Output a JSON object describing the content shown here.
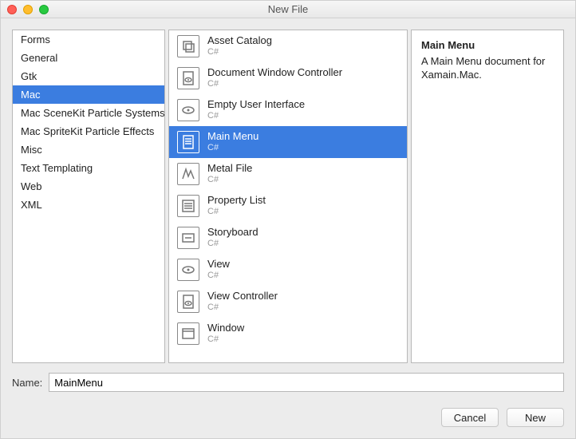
{
  "window": {
    "title": "New File"
  },
  "categories": [
    {
      "label": "Forms",
      "selected": false
    },
    {
      "label": "General",
      "selected": false
    },
    {
      "label": "Gtk",
      "selected": false
    },
    {
      "label": "Mac",
      "selected": true
    },
    {
      "label": "Mac SceneKit Particle Systems",
      "selected": false
    },
    {
      "label": "Mac SpriteKit Particle Effects",
      "selected": false
    },
    {
      "label": "Misc",
      "selected": false
    },
    {
      "label": "Text Templating",
      "selected": false
    },
    {
      "label": "Web",
      "selected": false
    },
    {
      "label": "XML",
      "selected": false
    }
  ],
  "templates": [
    {
      "label": "Asset Catalog",
      "sub": "C#",
      "icon": "stack",
      "selected": false
    },
    {
      "label": "Document Window Controller",
      "sub": "C#",
      "icon": "doc-eye",
      "selected": false
    },
    {
      "label": "Empty User Interface",
      "sub": "C#",
      "icon": "eye",
      "selected": false
    },
    {
      "label": "Main Menu",
      "sub": "C#",
      "icon": "doc-lines",
      "selected": true
    },
    {
      "label": "Metal File",
      "sub": "C#",
      "icon": "metal",
      "selected": false
    },
    {
      "label": "Property List",
      "sub": "C#",
      "icon": "list",
      "selected": false
    },
    {
      "label": "Storyboard",
      "sub": "C#",
      "icon": "storyboard",
      "selected": false
    },
    {
      "label": "View",
      "sub": "C#",
      "icon": "eye",
      "selected": false
    },
    {
      "label": "View Controller",
      "sub": "C#",
      "icon": "doc-eye",
      "selected": false
    },
    {
      "label": "Window",
      "sub": "C#",
      "icon": "window",
      "selected": false
    }
  ],
  "description": {
    "title": "Main Menu",
    "body": "A Main Menu document for Xamain.Mac."
  },
  "name_field": {
    "label": "Name:",
    "value": "MainMenu"
  },
  "buttons": {
    "cancel": "Cancel",
    "new": "New"
  },
  "icons": {
    "stack": "stack-icon",
    "doc-eye": "doc-eye-icon",
    "eye": "eye-icon",
    "doc-lines": "doc-lines-icon",
    "metal": "metal-icon",
    "list": "list-icon",
    "storyboard": "storyboard-icon",
    "window": "window-icon"
  }
}
